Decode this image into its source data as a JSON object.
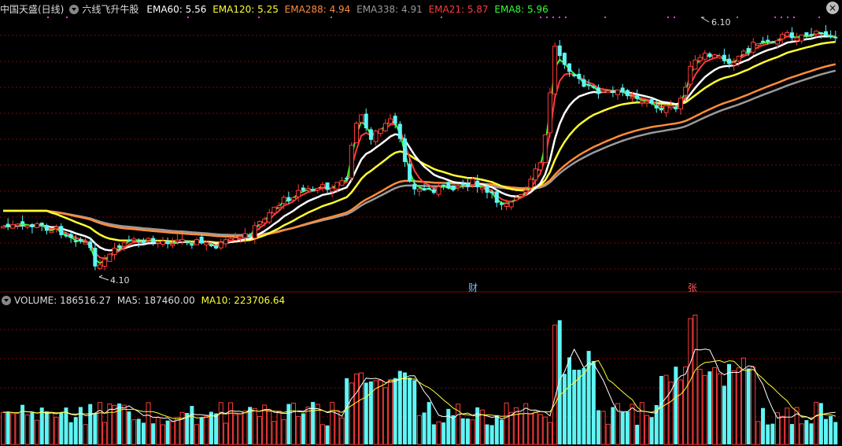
{
  "header": {
    "stock_name": "中国天盛(日线)",
    "indicator_name": "六线飞升牛股",
    "emas": [
      {
        "label": "EMA60: 5.56",
        "color": "#ffffff"
      },
      {
        "label": "EMA120: 5.25",
        "color": "#ffff33"
      },
      {
        "label": "EMA288: 4.94",
        "color": "#ff8c3a"
      },
      {
        "label": "EMA338: 4.91",
        "color": "#9a9a9a"
      },
      {
        "label": "EMA21: 5.87",
        "color": "#ff3b3b"
      },
      {
        "label": "EMA8: 5.96",
        "color": "#33ff33"
      }
    ],
    "close_icon": "close-icon"
  },
  "volume_header": {
    "title": "VOLUME: 186516.27",
    "ma5": "MA5: 187460.00",
    "ma10": "MA10: 223706.64"
  },
  "annotations": {
    "high": "6.10",
    "low": "4.10"
  },
  "markers": {
    "cai": "财",
    "zhang": "张"
  },
  "colors": {
    "up": "#ff3b3b",
    "down": "#5ff5f5",
    "background": "#000000",
    "grid": "#8b0000"
  }
}
